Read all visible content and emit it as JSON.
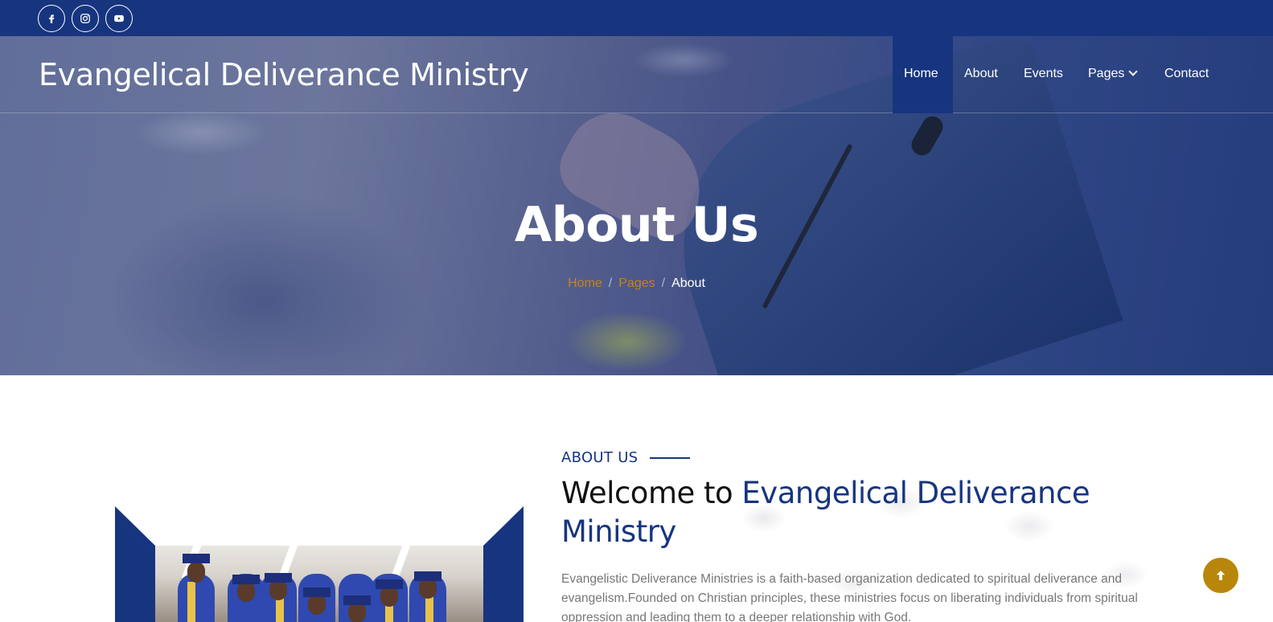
{
  "topbar": {
    "social": [
      {
        "icon": "facebook-icon"
      },
      {
        "icon": "instagram-icon"
      },
      {
        "icon": "youtube-icon"
      }
    ]
  },
  "nav": {
    "brand": "Evangelical Deliverance Ministry",
    "items": [
      {
        "label": "Home",
        "active": true
      },
      {
        "label": "About"
      },
      {
        "label": "Events"
      },
      {
        "label": "Pages",
        "dropdown": true
      },
      {
        "label": "Contact"
      }
    ]
  },
  "hero": {
    "title": "About Us",
    "breadcrumb": [
      {
        "label": "Home"
      },
      {
        "label": "Pages"
      },
      {
        "label": "About",
        "current": true
      }
    ],
    "separator": "/"
  },
  "about": {
    "label": "ABOUT US",
    "heading_prefix": "Welcome to ",
    "heading_highlight": "Evangelical Deliverance Ministry",
    "body": "Evangelistic Deliverance Ministries is a faith-based organization dedicated to spiritual deliverance and evangelism.Founded on Christian principles, these ministries focus on liberating individuals from spiritual oppression and leading them to a deeper relationship with God."
  },
  "colors": {
    "primary": "#17357f",
    "accent": "#c7831c",
    "scroll_top": "#b8860b"
  },
  "back_to_top": {
    "icon": "arrow-up-icon"
  }
}
